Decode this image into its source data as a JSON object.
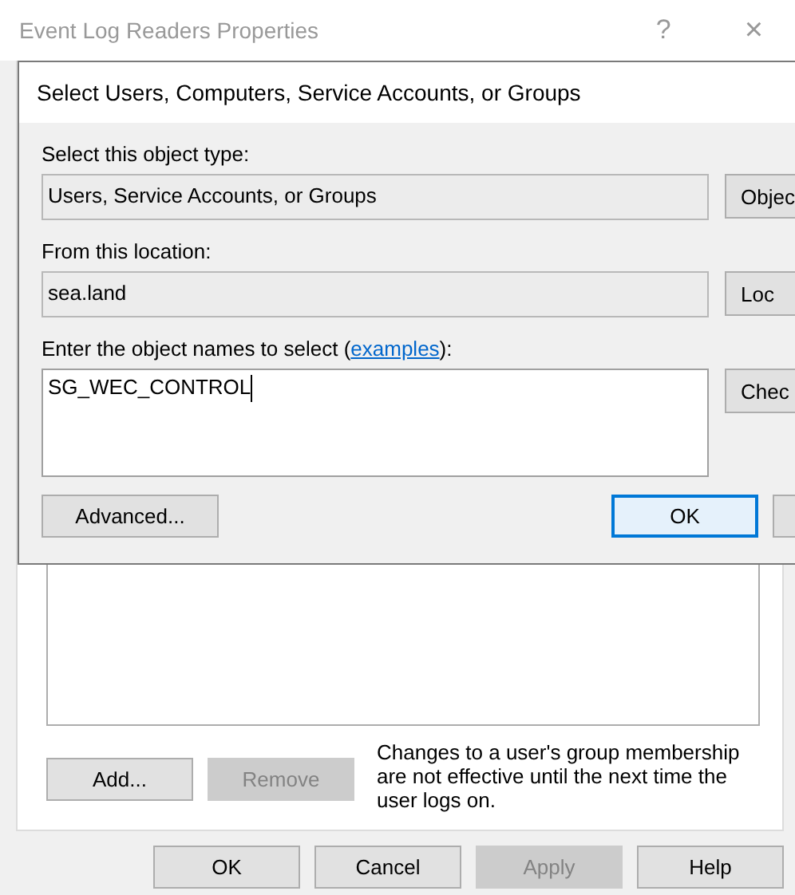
{
  "window": {
    "title": "Event Log Readers Properties",
    "help": "?",
    "close": "×"
  },
  "members": {
    "add": {
      "label": "Add...",
      "disabled": false
    },
    "remove": {
      "label": "Remove",
      "disabled": true
    },
    "note": "Changes to a user's group membership are not effective until the next time the user logs on."
  },
  "buttons": [
    {
      "label": "OK",
      "disabled": false
    },
    {
      "label": "Cancel",
      "disabled": false
    },
    {
      "label": "Apply",
      "disabled": true
    },
    {
      "label": "Help",
      "disabled": false
    }
  ],
  "dialog": {
    "title": "Select Users, Computers, Service Accounts, or Groups",
    "object_type": {
      "label": "Select this object type:",
      "value": "Users, Service Accounts, or Groups",
      "button": "Objec"
    },
    "location": {
      "label": "From this location:",
      "value": "sea.land",
      "button": "Loc"
    },
    "names": {
      "label_before": "Enter the object names to select (",
      "link": "examples",
      "label_after": "):",
      "value": "SG_WEC_CONTROL",
      "button": "Chec"
    },
    "advanced": "Advanced...",
    "ok": {
      "label": "OK",
      "focused": true
    }
  }
}
